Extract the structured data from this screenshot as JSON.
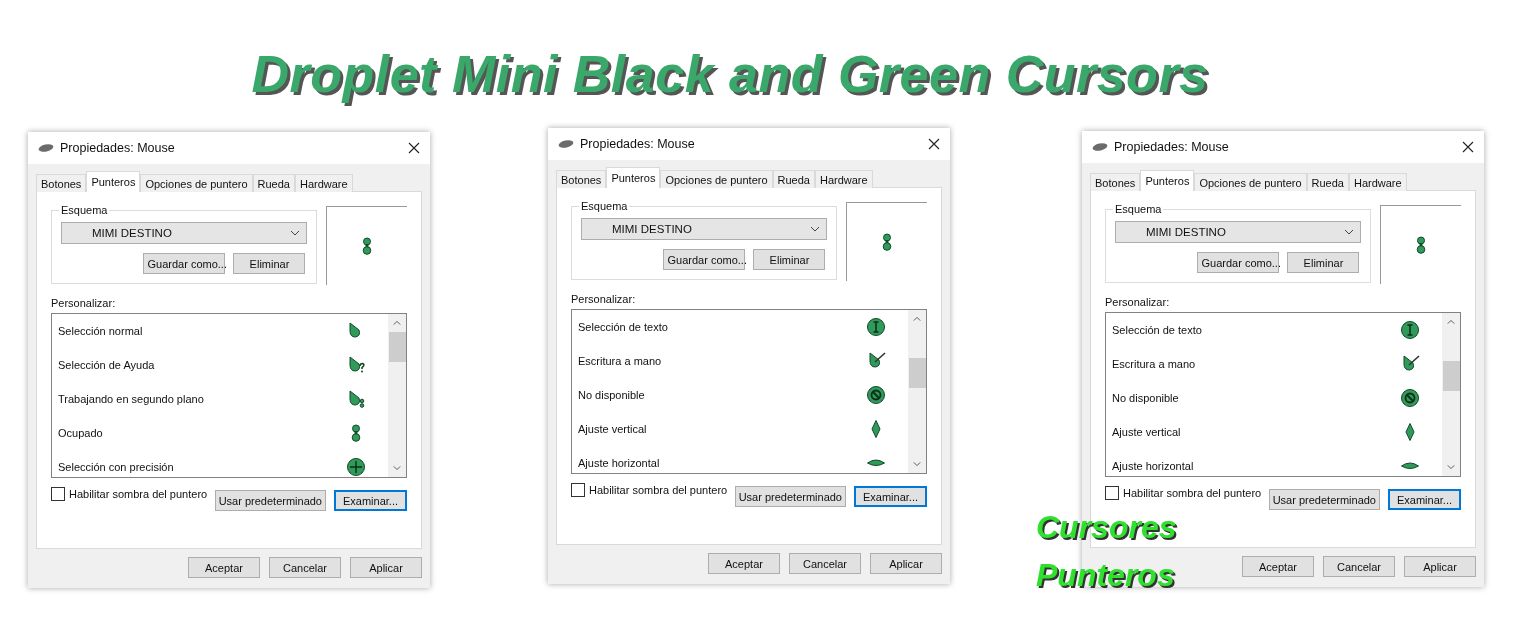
{
  "headline": "Droplet Mini Black and Green Cursors",
  "dialogs": [
    {
      "title": "Propiedades: Mouse",
      "tabs": [
        {
          "label": "Botones",
          "selected": false
        },
        {
          "label": "Punteros",
          "selected": true
        },
        {
          "label": "Opciones de puntero",
          "selected": false
        },
        {
          "label": "Rueda",
          "selected": false
        },
        {
          "label": "Hardware",
          "selected": false
        }
      ],
      "scheme_label": "Esquema",
      "scheme_value": "MIMI DESTINO",
      "scheme_buttons": [
        "Guardar como...",
        "Eliminar"
      ],
      "preview": {
        "kind": "busy"
      },
      "customize_label": "Personalizar:",
      "pointers": [
        {
          "name": "Selección normal",
          "kind": "normal"
        },
        {
          "name": "Selección de Ayuda",
          "kind": "help"
        },
        {
          "name": "Trabajando en segundo plano",
          "kind": "working"
        },
        {
          "name": "Ocupado",
          "kind": "busy"
        },
        {
          "name": "Selección con precisión",
          "kind": "precision"
        }
      ],
      "shadow": {
        "label": "Habilitar sombra del puntero",
        "checked": false
      },
      "actions": [
        {
          "label": "Usar predeterminado",
          "default": false
        },
        {
          "label": "Examinar...",
          "default": true
        }
      ],
      "footer_buttons": [
        "Aceptar",
        "Cancelar",
        "Aplicar"
      ]
    },
    {
      "title": "Propiedades: Mouse",
      "tabs": [
        {
          "label": "Botones",
          "selected": false
        },
        {
          "label": "Punteros",
          "selected": true
        },
        {
          "label": "Opciones de puntero",
          "selected": false
        },
        {
          "label": "Rueda",
          "selected": false
        },
        {
          "label": "Hardware",
          "selected": false
        }
      ],
      "scheme_label": "Esquema",
      "scheme_value": "MIMI DESTINO",
      "scheme_buttons": [
        "Guardar como...",
        "Eliminar"
      ],
      "preview": {
        "kind": "busy"
      },
      "customize_label": "Personalizar:",
      "pointers": [
        {
          "name": "Selección de texto",
          "kind": "text"
        },
        {
          "name": "Escritura a mano",
          "kind": "handwriting"
        },
        {
          "name": "No disponible",
          "kind": "unavailable"
        },
        {
          "name": "Ajuste vertical",
          "kind": "vertical"
        },
        {
          "name": "Ajuste horizontal",
          "kind": "horizontal"
        }
      ],
      "shadow": {
        "label": "Habilitar sombra del puntero",
        "checked": false
      },
      "actions": [
        {
          "label": "Usar predeterminado",
          "default": false
        },
        {
          "label": "Examinar...",
          "default": true
        }
      ],
      "footer_buttons": [
        "Aceptar",
        "Cancelar",
        "Aplicar"
      ]
    },
    {
      "title": "Propiedades: Mouse",
      "tabs": [
        {
          "label": "Botones",
          "selected": false
        },
        {
          "label": "Punteros",
          "selected": true
        },
        {
          "label": "Opciones de puntero",
          "selected": false
        },
        {
          "label": "Rueda",
          "selected": false
        },
        {
          "label": "Hardware",
          "selected": false
        }
      ],
      "scheme_label": "Esquema",
      "scheme_value": "MIMI DESTINO",
      "scheme_buttons": [
        "Guardar como...",
        "Eliminar"
      ],
      "preview": {
        "kind": "busy"
      },
      "customize_label": "Personalizar:",
      "pointers": [
        {
          "name": "Selección de texto",
          "kind": "text"
        },
        {
          "name": "Escritura a mano",
          "kind": "handwriting"
        },
        {
          "name": "No disponible",
          "kind": "unavailable"
        },
        {
          "name": "Ajuste vertical",
          "kind": "vertical"
        },
        {
          "name": "Ajuste horizontal",
          "kind": "horizontal"
        }
      ],
      "shadow": {
        "label": "Habilitar sombra del puntero",
        "checked": false
      },
      "actions": [
        {
          "label": "Usar predeterminado",
          "default": false
        },
        {
          "label": "Examinar...",
          "default": true
        }
      ],
      "footer_buttons": [
        "Aceptar",
        "Cancelar",
        "Aplicar"
      ]
    }
  ],
  "caption_lines": [
    "Cursores",
    "Punteros"
  ]
}
